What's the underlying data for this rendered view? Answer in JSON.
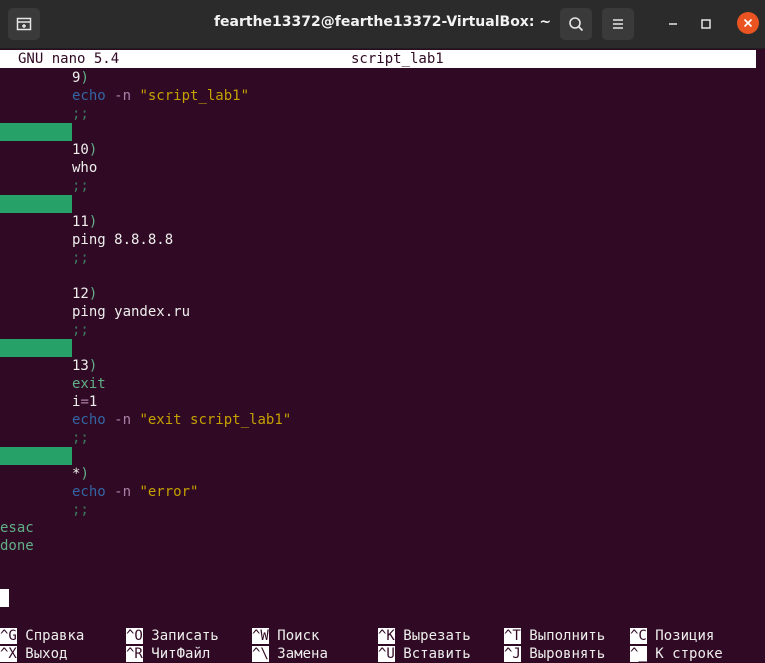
{
  "window": {
    "title": "fearthe13372@fearthe13372-VirtualBox: ~"
  },
  "nano": {
    "version_label": "GNU nano 5.4",
    "filename": "script_lab1"
  },
  "editor": {
    "lines": [
      {
        "indent": true,
        "parts": [
          {
            "t": "9",
            "c": "n"
          },
          {
            "t": ")",
            "c": "sym"
          }
        ]
      },
      {
        "indent": true,
        "parts": [
          {
            "t": "echo",
            "c": "kw"
          },
          {
            "t": " ",
            "c": "n"
          },
          {
            "t": "-n",
            "c": "op"
          },
          {
            "t": " ",
            "c": "n"
          },
          {
            "t": "\"script_lab1\"",
            "c": "str"
          }
        ]
      },
      {
        "indent": true,
        "parts": [
          {
            "t": ";;",
            "c": "semi"
          }
        ]
      },
      {
        "block": true,
        "parts": []
      },
      {
        "indent": true,
        "parts": [
          {
            "t": "10",
            "c": "n"
          },
          {
            "t": ")",
            "c": "sym"
          }
        ]
      },
      {
        "indent": true,
        "parts": [
          {
            "t": "who",
            "c": "n"
          }
        ]
      },
      {
        "indent": true,
        "parts": [
          {
            "t": ";;",
            "c": "semi"
          }
        ]
      },
      {
        "block": true,
        "parts": []
      },
      {
        "indent": true,
        "parts": [
          {
            "t": "11",
            "c": "n"
          },
          {
            "t": ")",
            "c": "sym"
          }
        ]
      },
      {
        "indent": true,
        "parts": [
          {
            "t": "ping 8.8.8.8",
            "c": "n"
          }
        ]
      },
      {
        "indent": true,
        "parts": [
          {
            "t": ";;",
            "c": "semi"
          }
        ]
      },
      {
        "parts": []
      },
      {
        "indent": true,
        "parts": [
          {
            "t": "12",
            "c": "n"
          },
          {
            "t": ")",
            "c": "sym"
          }
        ]
      },
      {
        "indent": true,
        "parts": [
          {
            "t": "ping yandex.ru",
            "c": "n"
          }
        ]
      },
      {
        "indent": true,
        "parts": [
          {
            "t": ";;",
            "c": "semi"
          }
        ]
      },
      {
        "block": true,
        "parts": []
      },
      {
        "indent": true,
        "parts": [
          {
            "t": "13",
            "c": "n"
          },
          {
            "t": ")",
            "c": "sym"
          }
        ]
      },
      {
        "indent": true,
        "parts": [
          {
            "t": "exit",
            "c": "grn"
          }
        ]
      },
      {
        "indent": true,
        "parts": [
          {
            "t": "i",
            "c": "n"
          },
          {
            "t": "=",
            "c": "op"
          },
          {
            "t": "1",
            "c": "n"
          }
        ]
      },
      {
        "indent": true,
        "parts": [
          {
            "t": "echo",
            "c": "kw"
          },
          {
            "t": " ",
            "c": "n"
          },
          {
            "t": "-n",
            "c": "op"
          },
          {
            "t": " ",
            "c": "n"
          },
          {
            "t": "\"exit script_lab1\"",
            "c": "str"
          }
        ]
      },
      {
        "indent": true,
        "parts": [
          {
            "t": ";;",
            "c": "semi"
          }
        ]
      },
      {
        "block": true,
        "parts": []
      },
      {
        "indent": true,
        "parts": [
          {
            "t": "*",
            "c": "n"
          },
          {
            "t": ")",
            "c": "sym"
          }
        ]
      },
      {
        "indent": true,
        "parts": [
          {
            "t": "echo",
            "c": "kw"
          },
          {
            "t": " ",
            "c": "n"
          },
          {
            "t": "-n",
            "c": "op"
          },
          {
            "t": " ",
            "c": "n"
          },
          {
            "t": "\"error\"",
            "c": "str"
          }
        ]
      },
      {
        "indent": true,
        "parts": [
          {
            "t": ";;",
            "c": "semi"
          }
        ]
      },
      {
        "parts": [
          {
            "t": "esac",
            "c": "grn"
          }
        ]
      },
      {
        "parts": [
          {
            "t": "done",
            "c": "grn"
          }
        ]
      }
    ]
  },
  "shortcuts": [
    {
      "key1": "^G",
      "label1": "Справка",
      "key2": "^X",
      "label2": "Выход"
    },
    {
      "key1": "^O",
      "label1": "Записать",
      "key2": "^R",
      "label2": "ЧитФайл"
    },
    {
      "key1": "^W",
      "label1": "Поиск",
      "key2": "^\\",
      "label2": "Замена"
    },
    {
      "key1": "^K",
      "label1": "Вырезать",
      "key2": "^U",
      "label2": "Вставить"
    },
    {
      "key1": "^T",
      "label1": "Выполнить",
      "key2": "^J",
      "label2": "Выровнять"
    },
    {
      "key1": "^C",
      "label1": "Позиция",
      "key2": "^_",
      "label2": "К строке"
    }
  ],
  "icons": {
    "new_tab": "new-tab-icon",
    "search": "search-icon",
    "menu": "hamburger-menu-icon",
    "minimize": "minimize-icon",
    "maximize": "maximize-icon",
    "close": "close-icon"
  },
  "colors": {
    "terminal_bg": "#300a24",
    "close_button": "#e95420",
    "block_green": "#26a269"
  }
}
